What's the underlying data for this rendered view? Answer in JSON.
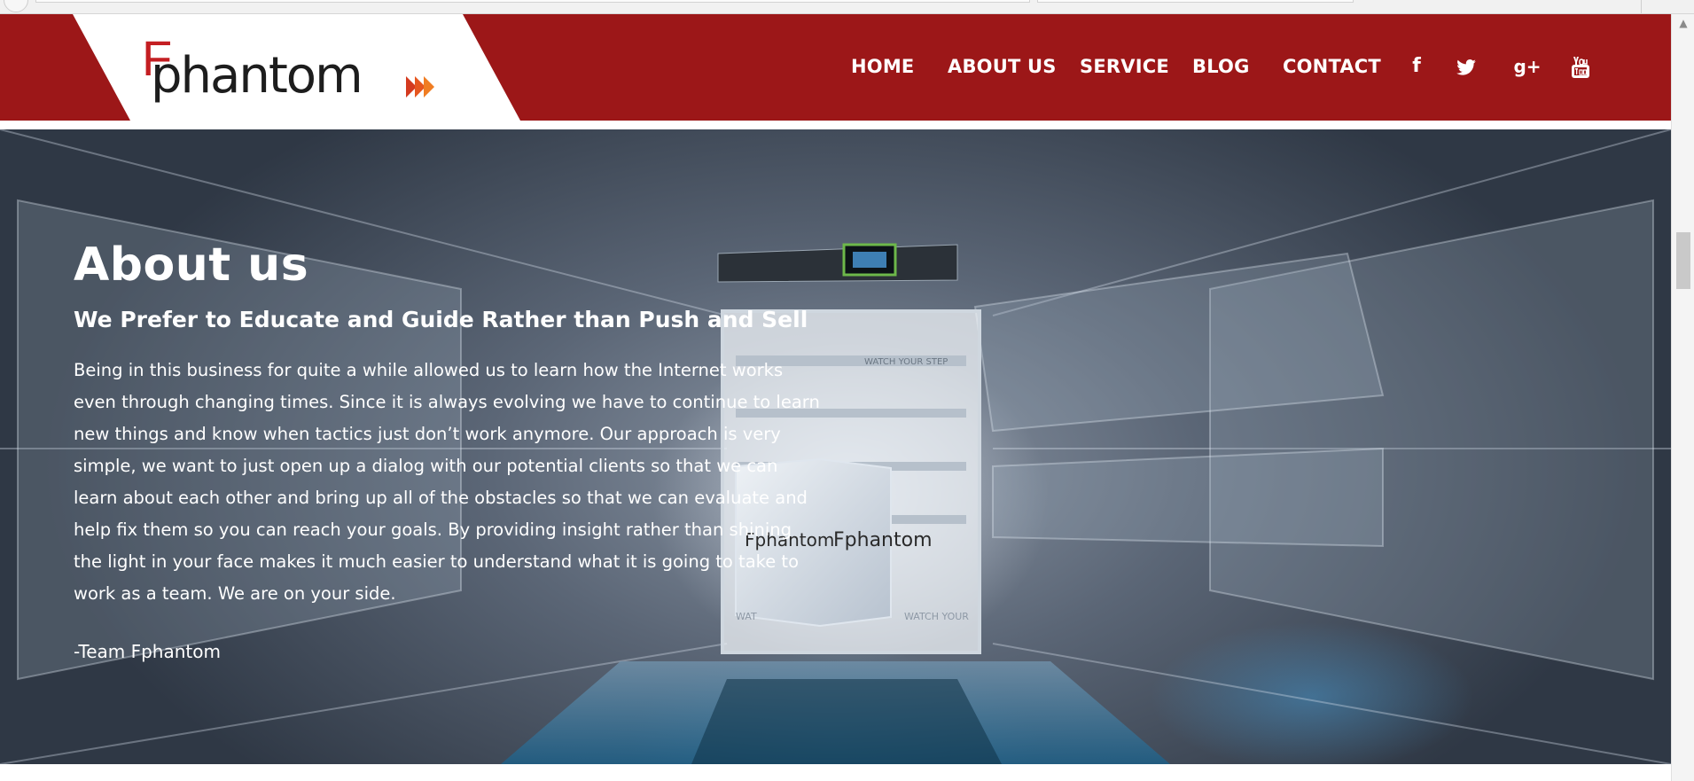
{
  "brand": {
    "logo_text": "Fphantom",
    "logo_f": "F",
    "logo_word": "phantom",
    "logo_color": "#c41e22"
  },
  "header": {
    "background": "#9c1718",
    "nav": [
      {
        "id": "home",
        "label": "HOME"
      },
      {
        "id": "about",
        "label": "ABOUT US"
      },
      {
        "id": "service",
        "label": "SERVICE"
      },
      {
        "id": "blog",
        "label": "BLOG"
      },
      {
        "id": "contact",
        "label": "CONTACT"
      }
    ],
    "social": [
      {
        "id": "facebook",
        "icon": "facebook-icon",
        "glyph": "f"
      },
      {
        "id": "twitter",
        "icon": "twitter-icon"
      },
      {
        "id": "google-plus",
        "icon": "google-plus-icon",
        "glyph": "g+"
      },
      {
        "id": "youtube",
        "icon": "youtube-icon"
      }
    ]
  },
  "hero": {
    "title": "About us",
    "subtitle": "We Prefer to Educate and Guide Rather than Push and Sell",
    "body_lines": [
      "Being in this business for quite a while allowed us to learn how the Internet works",
      "even through changing times. Since it is always evolving we have to continue to learn",
      "new things and know when tactics just don’t work anymore. Our approach is very",
      "simple, we want to just open up a dialog with our potential clients so that we can",
      "learn about each other and bring up all of the obstacles so that we can evaluate and",
      "help fix them so you can reach your goals. By providing insight rather than shining",
      "the light in your face makes it much easier to understand what it is going to take to",
      "work as a team. We are on your side."
    ],
    "signature": "-Team Fphantom",
    "background_text": {
      "cube_logo_1": "Fphantom",
      "cube_logo_2": "Fphantom",
      "door_sign_top": "WATCH YOUR STEP",
      "floor_sign": "WATCH YOUR",
      "floor_sign_left": "WAT"
    }
  }
}
